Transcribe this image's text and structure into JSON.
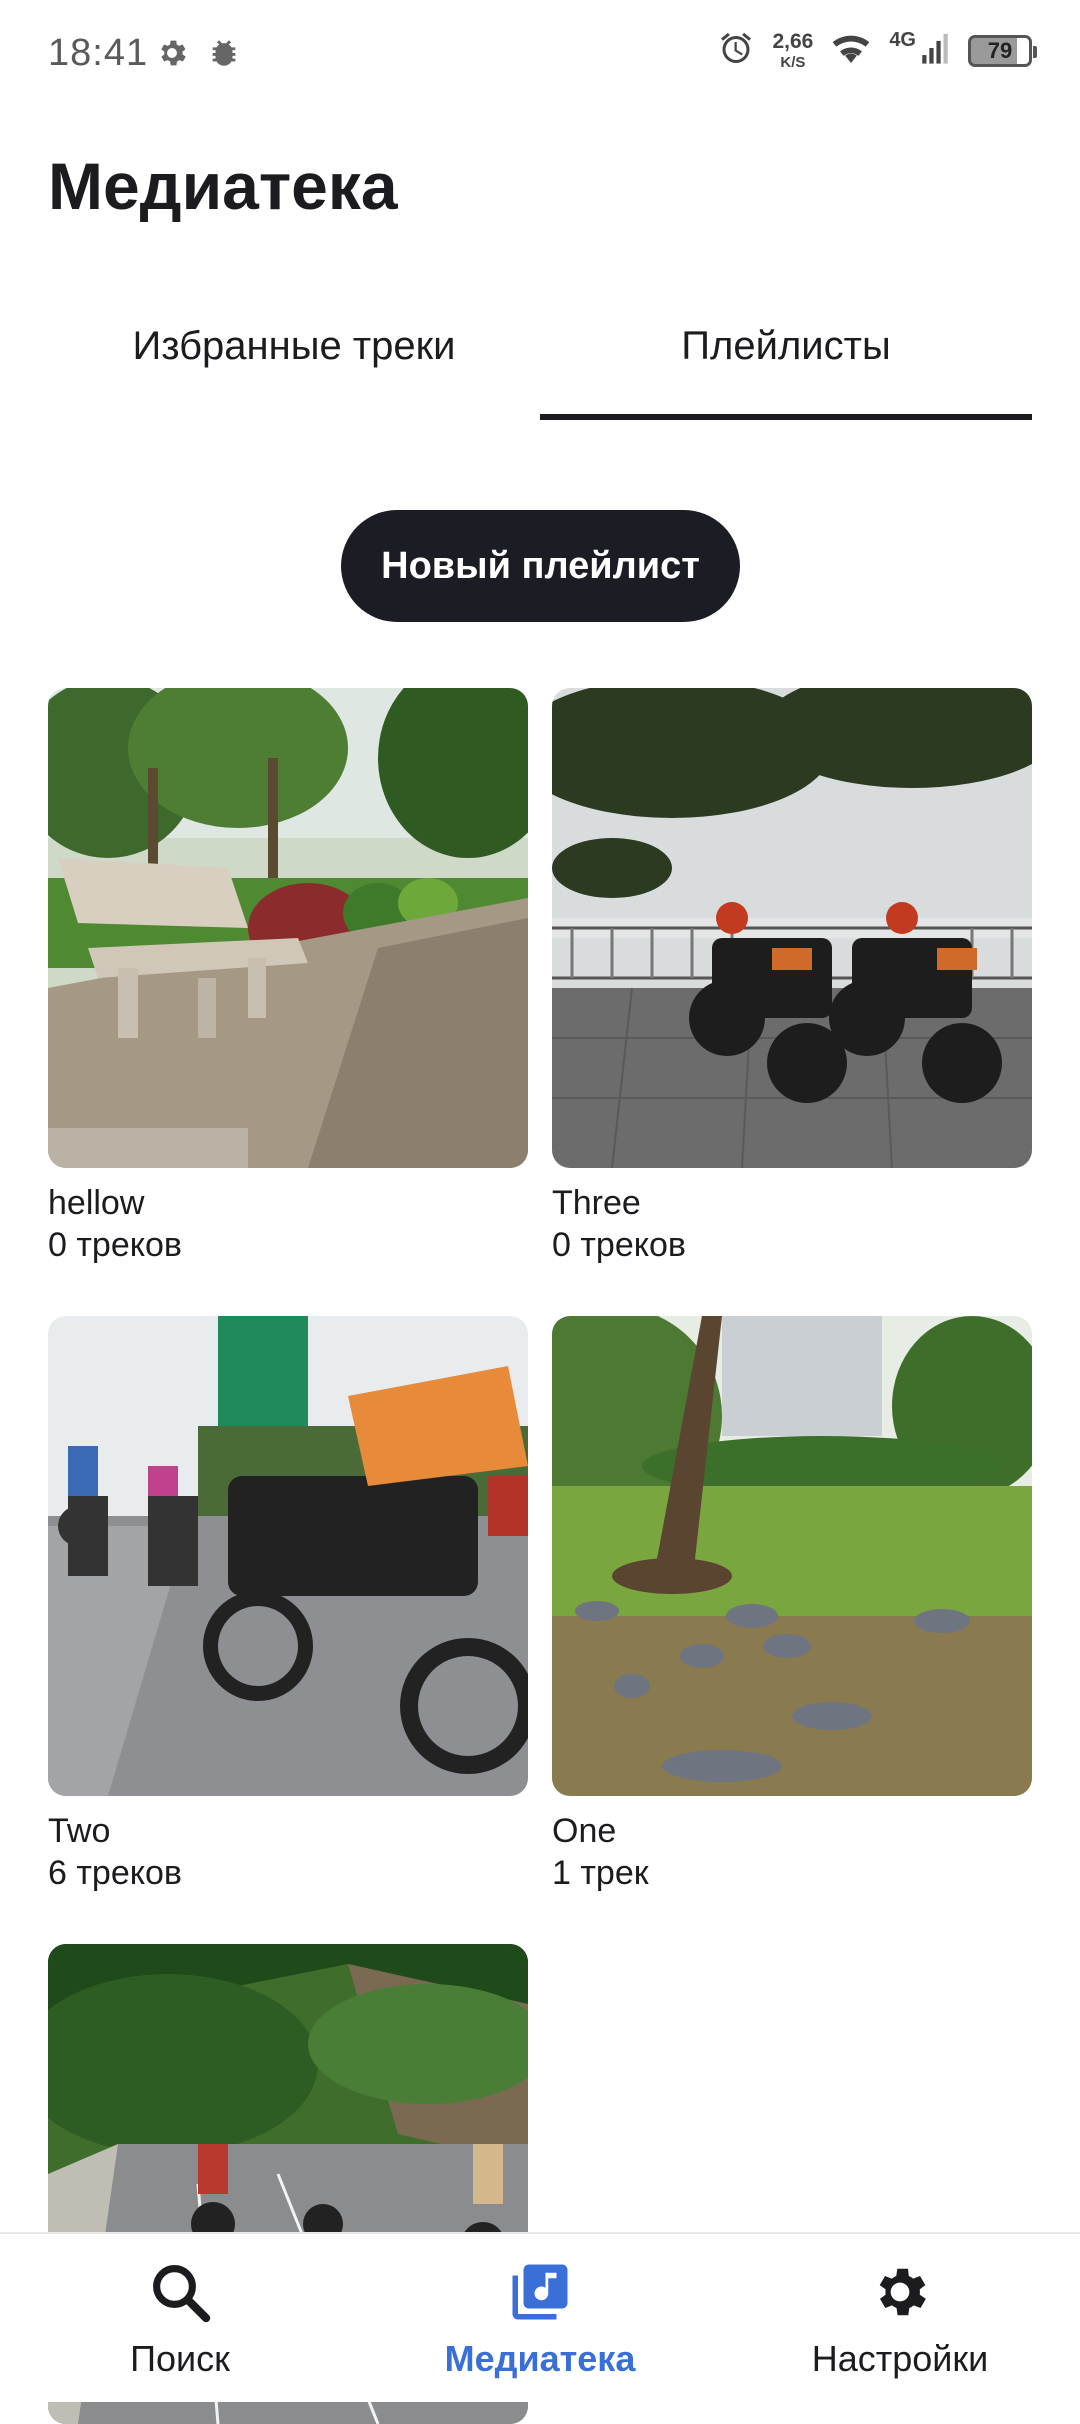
{
  "status_bar": {
    "time": "18:41",
    "speed_value": "2,66",
    "speed_unit": "K/S",
    "network": "4G",
    "battery": "79"
  },
  "header": {
    "title": "Медиатека"
  },
  "tabs": [
    {
      "label": "Избранные треки",
      "active": false
    },
    {
      "label": "Плейлисты",
      "active": true
    }
  ],
  "new_playlist_button": "Новый плейлист",
  "playlists": [
    {
      "name": "hellow",
      "count": "0 треков"
    },
    {
      "name": "Three",
      "count": "0 треков"
    },
    {
      "name": "Two",
      "count": "6 треков"
    },
    {
      "name": "One",
      "count": "1 трек"
    },
    {
      "name": "",
      "count": ""
    }
  ],
  "bottom_nav": [
    {
      "label": "Поиск",
      "icon": "search-icon",
      "active": false
    },
    {
      "label": "Медиатека",
      "icon": "music-library-icon",
      "active": true
    },
    {
      "label": "Настройки",
      "icon": "gear-icon",
      "active": false
    }
  ],
  "colors": {
    "accent": "#3a6fd8",
    "primary_text": "#1c1c20",
    "button_bg": "#1c1c24"
  }
}
